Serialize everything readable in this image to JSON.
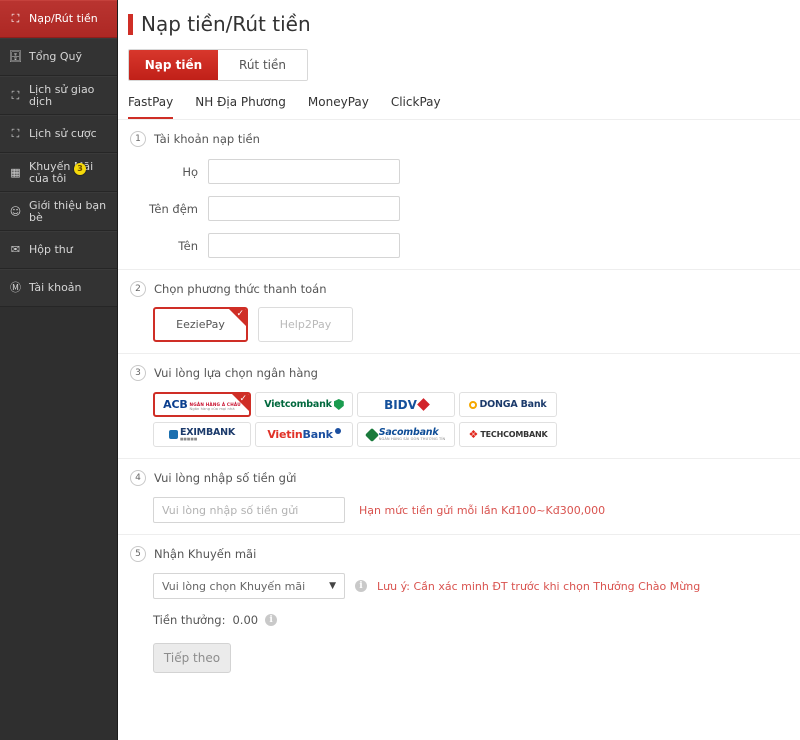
{
  "sidebar": {
    "items": [
      {
        "label": "Nạp/Rút tiền",
        "icon": "wallet-icon",
        "active": true,
        "badge": null
      },
      {
        "label": "Tổng Quỹ",
        "icon": "fund-icon",
        "active": false,
        "badge": null
      },
      {
        "label": "Lịch sử giao\ndịch",
        "icon": "history-icon",
        "active": false,
        "badge": null
      },
      {
        "label": "Lịch sử cược",
        "icon": "bet-history-icon",
        "active": false,
        "badge": null
      },
      {
        "label": "Khuyến Mãi\ncủa tôi",
        "icon": "promotion-icon",
        "active": false,
        "badge": "3"
      },
      {
        "label": "Giới thiệu bạn\nbè",
        "icon": "referral-icon",
        "active": false,
        "badge": null
      },
      {
        "label": "Hộp thư",
        "icon": "mail-icon",
        "active": false,
        "badge": null
      },
      {
        "label": "Tài khoản",
        "icon": "account-icon",
        "active": false,
        "badge": null
      }
    ]
  },
  "header": {
    "title": "Nạp tiền/Rút tiền"
  },
  "segment_tabs": [
    {
      "label": "Nạp tiền",
      "active": true
    },
    {
      "label": "Rút tiền",
      "active": false
    }
  ],
  "sub_tabs": [
    {
      "label": "FastPay",
      "active": true
    },
    {
      "label": "NH Địa Phương",
      "active": false
    },
    {
      "label": "MoneyPay",
      "active": false
    },
    {
      "label": "ClickPay",
      "active": false
    }
  ],
  "step1": {
    "number": "1",
    "title": "Tài khoản nạp tiền",
    "fields": [
      {
        "label": "Họ",
        "value": "",
        "placeholder": ""
      },
      {
        "label": "Tên đệm",
        "value": "",
        "placeholder": ""
      },
      {
        "label": "Tên",
        "value": "",
        "placeholder": ""
      }
    ]
  },
  "step2": {
    "number": "2",
    "title": "Chọn phương thức thanh toán",
    "options": [
      {
        "label": "EeziePay",
        "selected": true
      },
      {
        "label": "Help2Pay",
        "selected": false
      }
    ]
  },
  "step3": {
    "number": "3",
    "title": "Vui lòng lựa chọn ngân hàng",
    "banks": [
      {
        "name": "ACB",
        "sub": "NGÂN HÀNG Á CHÂU",
        "sub2": "Ngân hàng của mọi nhà",
        "selected": true
      },
      {
        "name": "Vietcombank",
        "sub": "",
        "selected": false
      },
      {
        "name": "BIDV",
        "sub": "",
        "selected": false
      },
      {
        "name": "DONGA Bank",
        "sub": "",
        "selected": false
      },
      {
        "name": "EXIMBANK",
        "sub": "",
        "selected": false
      },
      {
        "name": "VietinBank",
        "sub": "",
        "selected": false
      },
      {
        "name": "Sacombank",
        "sub": "NGÂN HÀNG SÀI GÒN THƯƠNG TÍN",
        "selected": false
      },
      {
        "name": "TECHCOMBANK",
        "sub": "",
        "selected": false
      }
    ]
  },
  "step4": {
    "number": "4",
    "title": "Vui lòng nhập số tiền gửi",
    "input_placeholder": "Vui lòng nhập số tiền gửi",
    "input_value": "",
    "limit_note": "Hạn mức tiền gửi mỗi lần Kđ100~Kđ300,000"
  },
  "step5": {
    "number": "5",
    "title": "Nhận Khuyến mãi",
    "select_value": "Vui lòng chọn Khuyến mãi",
    "caret": "▼",
    "info_icon": "i",
    "note": "Lưu ý: Cần xác minh ĐT trước khi chọn Thưởng Chào Mừng",
    "bonus_label": "Tiền thưởng:",
    "bonus_value": "0.00"
  },
  "footer": {
    "next_label": "Tiếp theo"
  },
  "colors": {
    "accent_red": "#cf2e26",
    "sidebar_bg": "#333333",
    "badge_yellow": "#f5d90a",
    "note_red": "#d9534f"
  }
}
